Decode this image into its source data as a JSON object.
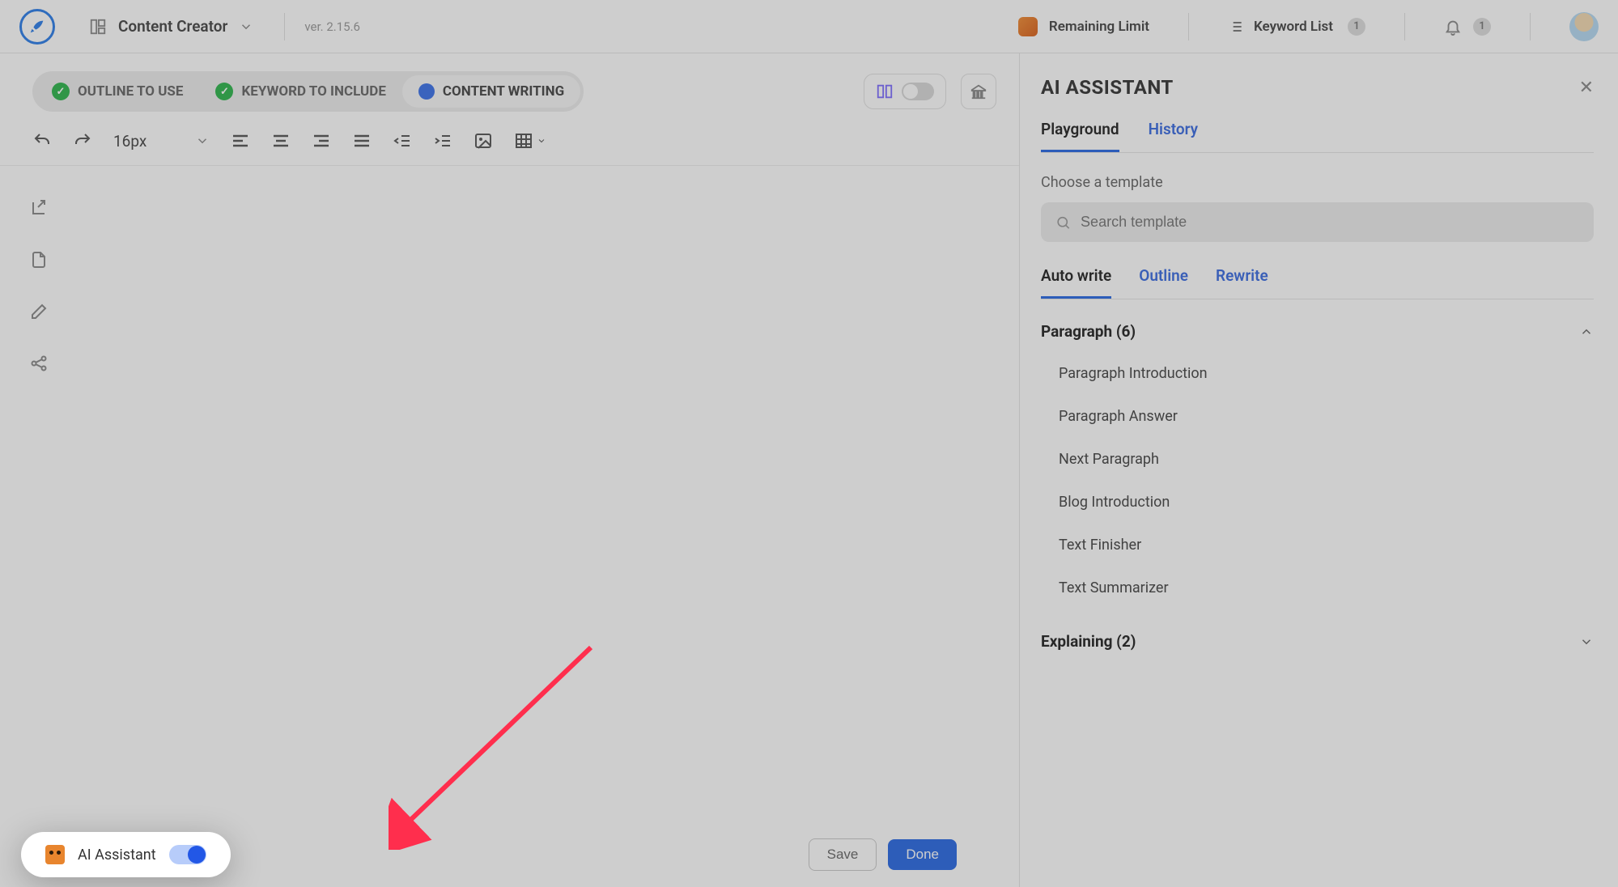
{
  "topbar": {
    "brand_title": "Content Creator",
    "version": "ver. 2.15.6",
    "remaining_label": "Remaining Limit",
    "keyword_list_label": "Keyword List",
    "keyword_badge": "1",
    "notif_badge": "1"
  },
  "steps": {
    "outline": "OUTLINE TO USE",
    "keyword": "KEYWORD TO INCLUDE",
    "content": "CONTENT WRITING"
  },
  "editor": {
    "font_size": "16px"
  },
  "bottom": {
    "ai_label": "AI Assistant",
    "save": "Save",
    "done": "Done"
  },
  "panel": {
    "title": "AI ASSISTANT",
    "tabs": {
      "playground": "Playground",
      "history": "History"
    },
    "choose_label": "Choose a template",
    "search_placeholder": "Search template",
    "subtabs": {
      "auto": "Auto write",
      "outline": "Outline",
      "rewrite": "Rewrite"
    },
    "sections": {
      "paragraph_title": "Paragraph (6)",
      "paragraph_items": [
        "Paragraph Introduction",
        "Paragraph Answer",
        "Next Paragraph",
        "Blog Introduction",
        "Text Finisher",
        "Text Summarizer"
      ],
      "explaining_title": "Explaining (2)"
    }
  }
}
